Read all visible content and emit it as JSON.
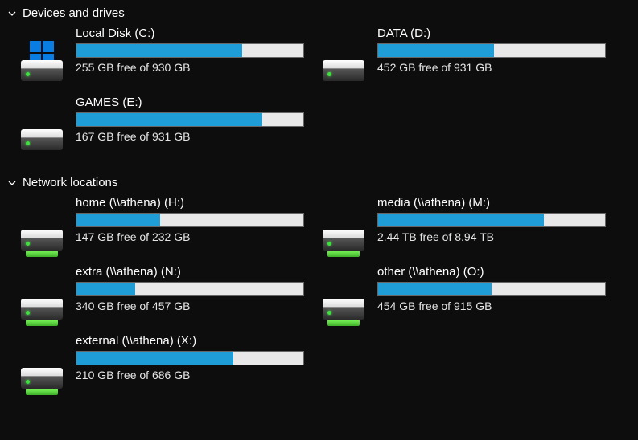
{
  "sections": [
    {
      "title": "Devices and drives",
      "expanded": true,
      "drives": [
        {
          "name": "Local Disk (C:)",
          "info": "255 GB free of 930 GB",
          "used_pct": 73,
          "icon": "system"
        },
        {
          "name": "DATA (D:)",
          "info": "452 GB free of 931 GB",
          "used_pct": 51,
          "icon": "hdd"
        },
        {
          "name": "GAMES (E:)",
          "info": "167 GB free of 931 GB",
          "used_pct": 82,
          "icon": "hdd"
        }
      ]
    },
    {
      "title": "Network locations",
      "expanded": true,
      "drives": [
        {
          "name": "home (\\\\athena) (H:)",
          "info": "147 GB free of 232 GB",
          "used_pct": 37,
          "icon": "net"
        },
        {
          "name": "media (\\\\athena) (M:)",
          "info": "2.44 TB free of 8.94 TB",
          "used_pct": 73,
          "icon": "net"
        },
        {
          "name": "extra (\\\\athena) (N:)",
          "info": "340 GB free of 457 GB",
          "used_pct": 26,
          "icon": "net"
        },
        {
          "name": "other (\\\\athena) (O:)",
          "info": "454 GB free of 915 GB",
          "used_pct": 50,
          "icon": "net"
        },
        {
          "name": "external (\\\\athena) (X:)",
          "info": "210 GB free of 686 GB",
          "used_pct": 69,
          "icon": "net"
        }
      ]
    }
  ]
}
